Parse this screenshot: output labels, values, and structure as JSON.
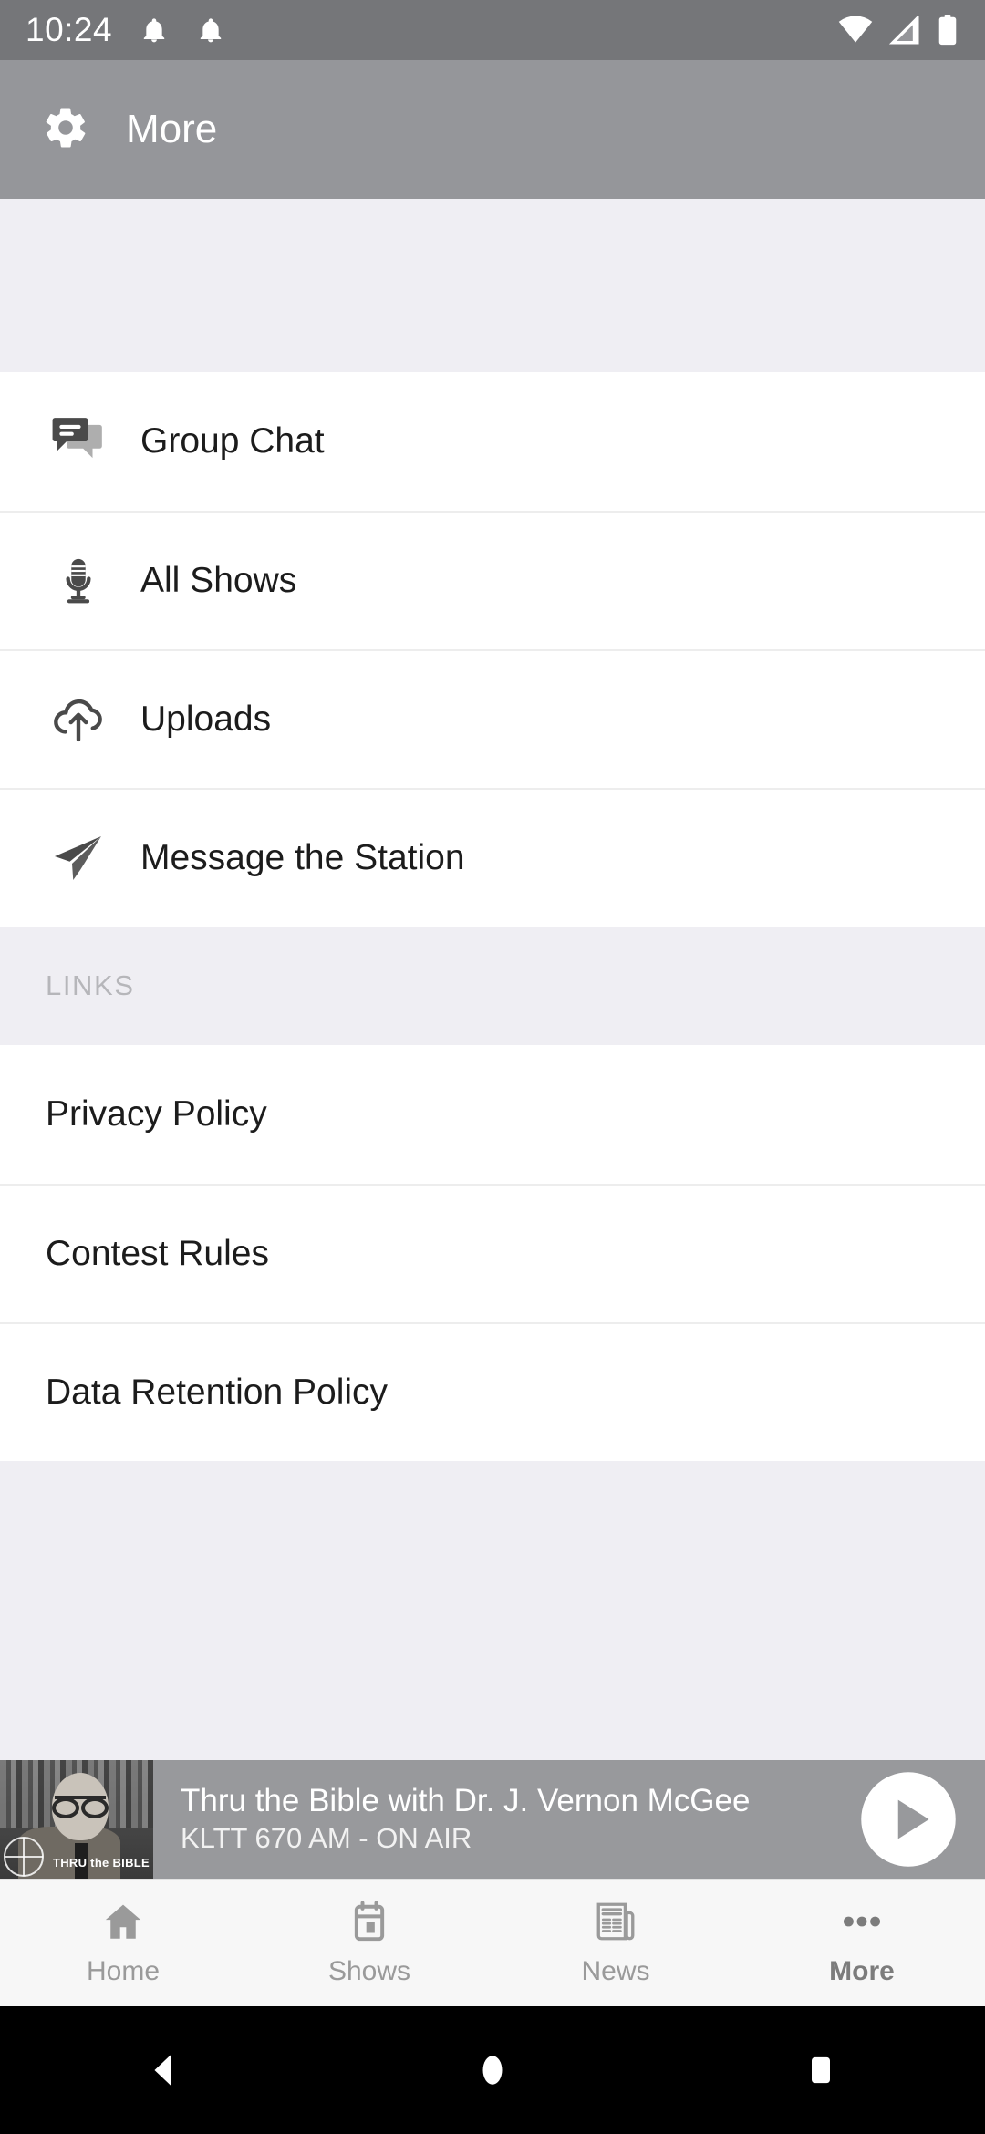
{
  "status_bar": {
    "clock": "10:24",
    "left_icons": [
      "notification-bell-icon",
      "notification-bell-icon"
    ],
    "right_icons": [
      "wifi-icon",
      "cellular-signal-icon",
      "battery-icon"
    ]
  },
  "app_bar": {
    "icon": "gear-icon",
    "title": "More"
  },
  "menu": {
    "items": [
      {
        "label": "Group Chat",
        "icon": "chat-bubbles-icon"
      },
      {
        "label": "All Shows",
        "icon": "microphone-icon"
      },
      {
        "label": "Uploads",
        "icon": "cloud-upload-icon"
      },
      {
        "label": "Message the Station",
        "icon": "paper-plane-icon"
      }
    ]
  },
  "links_section": {
    "header": "LINKS",
    "items": [
      {
        "label": "Privacy Policy"
      },
      {
        "label": "Contest Rules"
      },
      {
        "label": "Data Retention Policy"
      }
    ]
  },
  "now_playing": {
    "artwork_label": "THRU the BIBLE",
    "title": "Thru the Bible with Dr. J. Vernon McGee",
    "subtitle": "KLTT 670 AM - ON AIR",
    "play_button": "play-icon"
  },
  "bottom_nav": {
    "items": [
      {
        "label": "Home",
        "icon": "home-icon",
        "active": false
      },
      {
        "label": "Shows",
        "icon": "calendar-icon",
        "active": false
      },
      {
        "label": "News",
        "icon": "newspaper-icon",
        "active": false
      },
      {
        "label": "More",
        "icon": "ellipsis-icon",
        "active": true
      }
    ]
  },
  "system_nav": {
    "back": "back-triangle-icon",
    "home": "home-circle-icon",
    "recents": "recents-square-icon"
  },
  "colors": {
    "status_bar": "#757679",
    "app_bar": "#95969A",
    "page_background": "#EFEEF3",
    "row_background": "#FFFFFF",
    "divider": "#EDEDED",
    "section_header_text": "#B6B6BA",
    "primary_text": "#1C1C1C",
    "player_bar": "#98999C",
    "bottom_nav_background": "#F7F7F7",
    "nav_inactive": "#9A9A9A",
    "nav_active": "#7C7C7C",
    "system_nav": "#000000"
  }
}
